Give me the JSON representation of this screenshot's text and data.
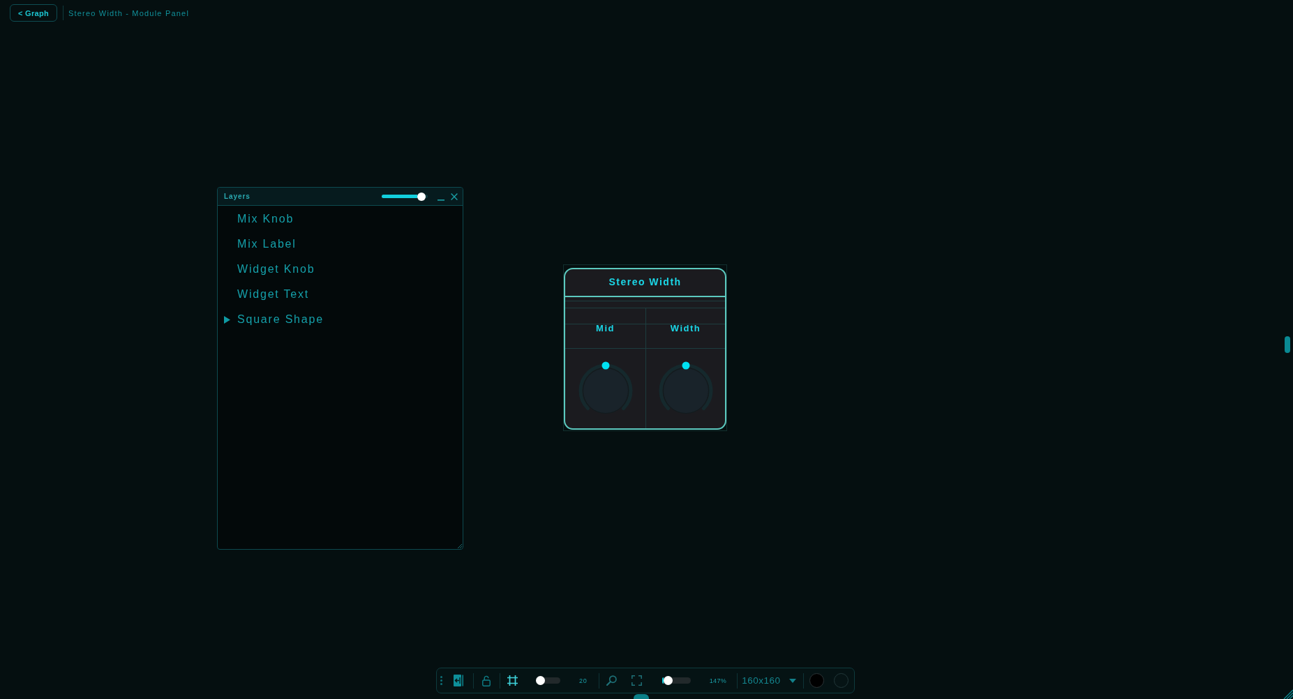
{
  "top_bar": {
    "back_button": "< Graph",
    "title": "Stereo Width - Module Panel"
  },
  "layers_panel": {
    "title": "Layers",
    "slider": {
      "level": 0.95
    },
    "items": [
      {
        "kind": "layer",
        "label": "Mix Knob"
      },
      {
        "kind": "layer",
        "label": "Mix Label"
      },
      {
        "kind": "layer",
        "label": "Widget Knob"
      },
      {
        "kind": "layer",
        "label": "Widget Text"
      },
      {
        "kind": "group",
        "label": "Square Shape",
        "expanded": false
      }
    ]
  },
  "module_panel": {
    "title": "Stereo Width",
    "knobs": [
      {
        "label": "Mid",
        "level": 0.5
      },
      {
        "label": "Width",
        "level": 0.5
      }
    ]
  },
  "toolbar": {
    "grid_slider": {
      "level": 0
    },
    "grid_size": "20",
    "zoom_slider": {
      "level": 0.1
    },
    "zoom": "147%",
    "canvas_size": "160x160",
    "swatches": [
      {
        "color": "#000000"
      },
      {
        "color": "#061415"
      }
    ]
  }
}
